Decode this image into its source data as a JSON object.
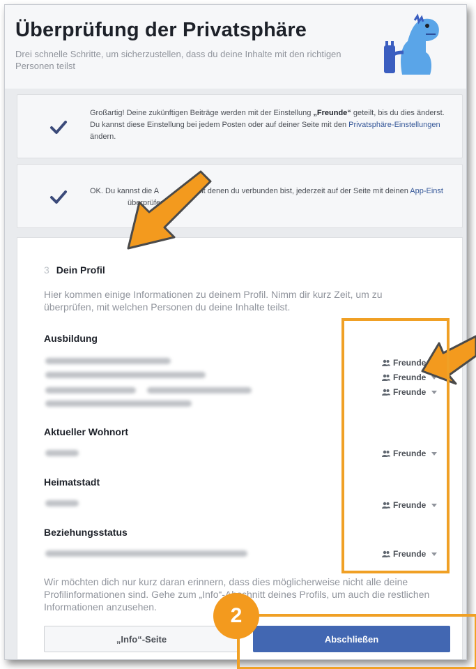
{
  "header": {
    "title": "Überprüfung der Privatsphäre",
    "subtitle": "Drei schnelle Schritte, um sicherzustellen, dass du deine Inhalte mit den richtigen Personen teilst"
  },
  "step1": {
    "text_a": "Großartig! Deine zukünftigen Beiträge werden mit der Einstellung ",
    "bold": "„Freunde“",
    "text_b": " geteilt, bis du dies änderst. Du kannst diese Einstellung bei jedem Posten oder auf deiner Seite mit den ",
    "link": "Privatsphäre-Einstellungen",
    "text_c": " ändern."
  },
  "step2": {
    "text_a": "OK. Du kannst die A",
    "text_b": "mit denen du verbunden bist, jederzeit auf der Seite mit deinen ",
    "link": "App-Einst",
    "text_c": "überprüfen."
  },
  "step3": {
    "number": "3",
    "title": "Dein Profil",
    "intro": "Hier kommen einige Informationen zu deinem Profil. Nimm dir kurz Zeit, um zu überprüfen, mit welchen Personen du deine Inhalte teilst.",
    "sections": {
      "education": "Ausbildung",
      "current_city": "Aktueller Wohnort",
      "hometown": "Heimatstadt",
      "relationship": "Beziehungsstatus"
    },
    "audience": "Freunde",
    "reminder": "Wir möchten dich nur kurz daran erinnern, dass dies möglicherweise nicht alle deine Profilinformationen sind. Gehe zum „Info“-Abschnitt deines Profils, um auch die restlichen Informationen anzusehen.",
    "info_button": "„Info“-Seite",
    "finish_button": "Abschließen"
  },
  "annotation": {
    "badge": "2"
  },
  "colors": {
    "accent": "#4267b2",
    "highlight": "#f0a025",
    "check": "#3b4a7a"
  }
}
